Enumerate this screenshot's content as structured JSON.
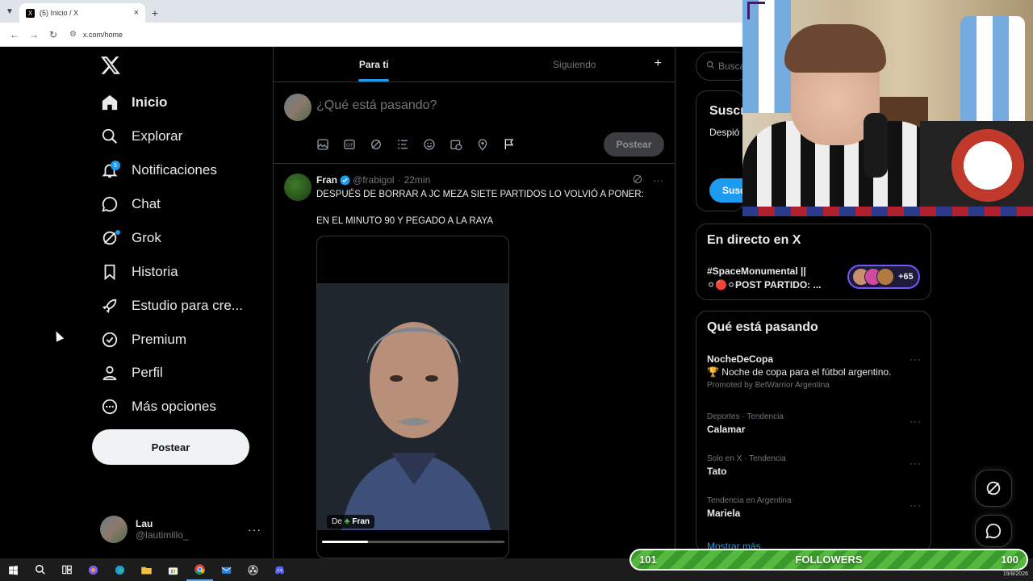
{
  "browser": {
    "tab_title": "(5) Inicio / X",
    "url": "x.com/home"
  },
  "nav": {
    "items": [
      {
        "label": "Inicio",
        "icon": "home-icon",
        "active": true
      },
      {
        "label": "Explorar",
        "icon": "search-icon"
      },
      {
        "label": "Notificaciones",
        "icon": "bell-icon",
        "badge": "5"
      },
      {
        "label": "Chat",
        "icon": "chat-icon"
      },
      {
        "label": "Grok",
        "icon": "grok-icon"
      },
      {
        "label": "Historia",
        "icon": "bookmark-icon"
      },
      {
        "label": "Estudio para cre...",
        "icon": "rocket-icon"
      },
      {
        "label": "Premium",
        "icon": "verified-icon"
      },
      {
        "label": "Perfil",
        "icon": "person-icon"
      },
      {
        "label": "Más opciones",
        "icon": "more-circle-icon"
      }
    ],
    "post_label": "Postear"
  },
  "account": {
    "name": "Lau",
    "handle": "@lautimillo_"
  },
  "timeline": {
    "tabs": [
      "Para ti",
      "Siguiendo"
    ],
    "compose_placeholder": "¿Qué está pasando?",
    "compose_post": "Postear"
  },
  "tweet": {
    "name": "Fran",
    "handle": "@frabigol",
    "sep": "·",
    "time": "22min",
    "line1": "DESPUÉS DE BORRAR A JC MEZA SIETE PARTIDOS LO VOLVIÓ A PONER:",
    "line2": "EN EL MINUTO 90 Y PEGADO A LA RAYA",
    "media_from": "De",
    "media_author": "Fran",
    "progress": 0.25
  },
  "sidebar": {
    "search_placeholder": "Busca",
    "subscribe": {
      "title": "Suscr",
      "desc": "Despió estadís aprovec",
      "button": "Susc"
    },
    "live": {
      "title": "En directo en X",
      "text": "#SpaceMonumental || ⚪🔴⚪POST PARTIDO: ...",
      "count": "+65"
    },
    "trends": {
      "title": "Qué está pasando",
      "items": [
        {
          "name": "NocheDeCopa",
          "desc": "🏆 Noche de copa para el fútbol argentino.",
          "promo": "Promoted by BetWarrior Argentina"
        },
        {
          "meta": "Deportes · Tendencia",
          "name": "Calamar"
        },
        {
          "meta": "Solo en X · Tendencia",
          "name": "Tato"
        },
        {
          "meta": "Tendencia en Argentina",
          "name": "Mariela"
        }
      ],
      "show_more": "Mostrar más"
    }
  },
  "overlay": {
    "followers_left": "101",
    "followers_label": "FOLLOWERS",
    "followers_right": "100"
  },
  "taskbar": {
    "date": "19/8/2026"
  },
  "colors": {
    "accent": "#1d9bf0",
    "background": "#000000",
    "border": "#2f3336",
    "muted": "#71767b"
  }
}
